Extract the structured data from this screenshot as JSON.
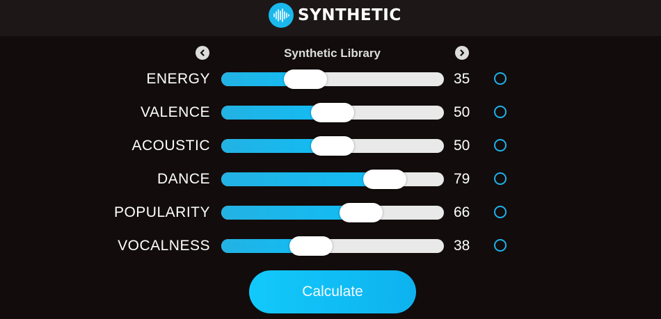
{
  "app": {
    "name": "SYNTHETIC",
    "accent_color": "#1ab8ec"
  },
  "library_nav": {
    "title": "Synthetic Library",
    "prev_icon": "chevron-left-icon",
    "next_icon": "chevron-right-icon"
  },
  "sliders": [
    {
      "label": "ENERGY",
      "value": 35,
      "display": "35"
    },
    {
      "label": "VALENCE",
      "value": 50,
      "display": "50"
    },
    {
      "label": "ACOUSTIC",
      "value": 50,
      "display": "50"
    },
    {
      "label": "DANCE",
      "value": 79,
      "display": "79"
    },
    {
      "label": "POPULARITY",
      "value": 66,
      "display": "66"
    },
    {
      "label": "VOCALNESS",
      "value": 38,
      "display": "38"
    }
  ],
  "slider_range": {
    "min": 0,
    "max": 100
  },
  "calculate_label": "Calculate"
}
